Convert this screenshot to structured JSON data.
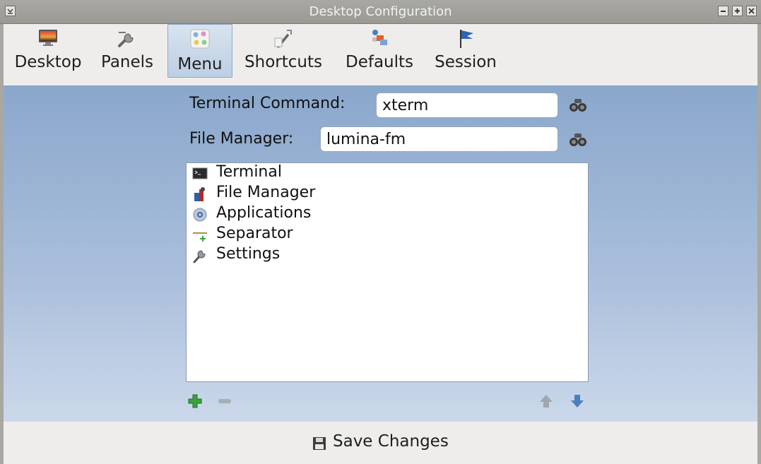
{
  "window": {
    "title": "Desktop Configuration"
  },
  "toolbar": {
    "items": [
      {
        "label": "Desktop",
        "icon": "desktop-icon"
      },
      {
        "label": "Panels",
        "icon": "panels-icon"
      },
      {
        "label": "Menu",
        "icon": "menu-icon",
        "active": true
      },
      {
        "label": "Shortcuts",
        "icon": "shortcuts-icon"
      },
      {
        "label": "Defaults",
        "icon": "defaults-icon"
      },
      {
        "label": "Session",
        "icon": "session-icon"
      }
    ]
  },
  "form": {
    "terminal_label": "Terminal Command:",
    "terminal_value": "xterm",
    "filemanager_label": "File Manager:",
    "filemanager_value": "lumina-fm"
  },
  "menu_items": [
    {
      "label": "Terminal",
      "icon": "terminal-icon"
    },
    {
      "label": "File Manager",
      "icon": "file-manager-icon"
    },
    {
      "label": "Applications",
      "icon": "applications-icon"
    },
    {
      "label": "Separator",
      "icon": "separator-icon"
    },
    {
      "label": "Settings",
      "icon": "settings-icon"
    }
  ],
  "footer": {
    "save_label": "Save Changes"
  },
  "colors": {
    "accent": "#4a7fc1",
    "panel_top": "#8aa7cc",
    "panel_bottom": "#cbd8ea",
    "add_green": "#3aa33a"
  }
}
